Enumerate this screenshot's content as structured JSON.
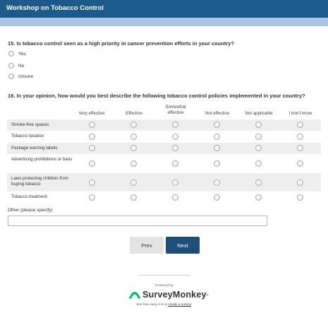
{
  "header": {
    "title": "Workshop on Tobacco Control"
  },
  "colors": {
    "header": "#1d5a8c",
    "subband": "#a9c5e6",
    "next_button": "#1f4e79",
    "logo_green": "#00bf6f"
  },
  "question15": {
    "title": "15. Is tobacco control seen as a high priority in cancer prevention efforts in your country?",
    "options": [
      "Yes",
      "No",
      "Unsure"
    ]
  },
  "question16": {
    "title": "16. In your opinion, how would you best describe the following tobacco control policies implemented in your country?",
    "columns": [
      "Very effective",
      "Effective",
      "Somewhat effective",
      "Not effective",
      "Not applicable",
      "I don't know"
    ],
    "rows": [
      "Smoke-free spaces",
      "Tobacco taxation",
      "Package warning labels",
      "Advertising prohibitions or bans",
      "Laws protecting children from buying tobacco",
      "Tobacco treatment"
    ]
  },
  "other": {
    "label": "Other (please specify)",
    "value": ""
  },
  "nav": {
    "prev_label": "Prev",
    "next_label": "Next"
  },
  "footer": {
    "powered_by": "Powered by",
    "logo_text": "SurveyMonkey",
    "logo_icon": "surveymonkey-logo-icon",
    "tagline_prefix": "See how easy it is to ",
    "tagline_link": "create a survey",
    "tagline_suffix": "."
  }
}
